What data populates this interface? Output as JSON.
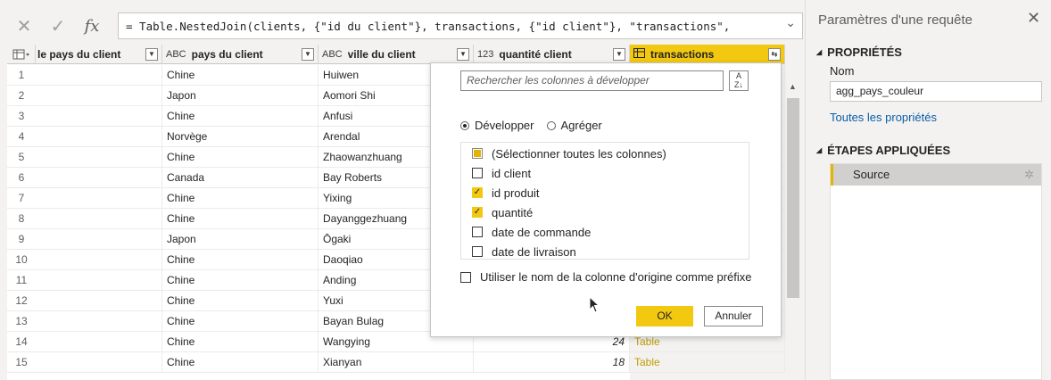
{
  "formula_bar": {
    "cancel_icon": "close-icon",
    "confirm_icon": "check-icon",
    "fx_label": "fx",
    "formula": "= Table.NestedJoin(clients, {\"id du client\"}, transactions, {\"id client\"}, \"transactions\","
  },
  "grid": {
    "columns": [
      {
        "type": "",
        "label": "le pays du client"
      },
      {
        "type": "ABC",
        "label": "pays du client"
      },
      {
        "type": "ABC",
        "label": "ville du client"
      },
      {
        "type": "123",
        "label": "quantité client"
      },
      {
        "type": "",
        "label": "transactions"
      }
    ],
    "rows": [
      {
        "n": "1",
        "pays": "Chine",
        "ville": "Huiwen",
        "qte": "",
        "trans": ""
      },
      {
        "n": "2",
        "pays": "Japon",
        "ville": "Aomori Shi",
        "qte": "",
        "trans": ""
      },
      {
        "n": "3",
        "pays": "Chine",
        "ville": "Anfusi",
        "qte": "",
        "trans": ""
      },
      {
        "n": "4",
        "pays": "Norvège",
        "ville": "Arendal",
        "qte": "",
        "trans": ""
      },
      {
        "n": "5",
        "pays": "Chine",
        "ville": "Zhaowanzhuang",
        "qte": "",
        "trans": ""
      },
      {
        "n": "6",
        "pays": "Canada",
        "ville": "Bay Roberts",
        "qte": "",
        "trans": ""
      },
      {
        "n": "7",
        "pays": "Chine",
        "ville": "Yixing",
        "qte": "",
        "trans": ""
      },
      {
        "n": "8",
        "pays": "Chine",
        "ville": "Dayanggezhuang",
        "qte": "",
        "trans": ""
      },
      {
        "n": "9",
        "pays": "Japon",
        "ville": "Ōgaki",
        "qte": "",
        "trans": ""
      },
      {
        "n": "10",
        "pays": "Chine",
        "ville": "Daoqiao",
        "qte": "",
        "trans": ""
      },
      {
        "n": "11",
        "pays": "Chine",
        "ville": "Anding",
        "qte": "",
        "trans": ""
      },
      {
        "n": "12",
        "pays": "Chine",
        "ville": "Yuxi",
        "qte": "",
        "trans": ""
      },
      {
        "n": "13",
        "pays": "Chine",
        "ville": "Bayan Bulag",
        "qte": "",
        "trans": ""
      },
      {
        "n": "14",
        "pays": "Chine",
        "ville": "Wangying",
        "qte": "24",
        "trans": "Table"
      },
      {
        "n": "15",
        "pays": "Chine",
        "ville": "Xianyan",
        "qte": "18",
        "trans": "Table"
      }
    ]
  },
  "popup": {
    "search_placeholder": "Rechercher les colonnes à développer",
    "sort_icon": "sort-az-icon",
    "radio_expand": "Développer",
    "radio_aggregate": "Agréger",
    "selected_mode": "Développer",
    "columns": [
      {
        "label": "(Sélectionner toutes les colonnes)",
        "state": "partial"
      },
      {
        "label": "id client",
        "state": "off"
      },
      {
        "label": "id produit",
        "state": "on"
      },
      {
        "label": "quantité",
        "state": "on"
      },
      {
        "label": "date de commande",
        "state": "off"
      },
      {
        "label": "date de livraison",
        "state": "off"
      }
    ],
    "prefix_label": "Utiliser le nom de la colonne d'origine comme préfixe",
    "ok_label": "OK",
    "cancel_label": "Annuler"
  },
  "right_panel": {
    "title": "Paramètres d'une requête",
    "properties_heading": "PROPRIÉTÉS",
    "name_label": "Nom",
    "name_value": "agg_pays_couleur",
    "all_properties_link": "Toutes les propriétés",
    "steps_heading": "ÉTAPES APPLIQUÉES",
    "steps": [
      {
        "label": "Source"
      }
    ]
  },
  "colors": {
    "accent": "#f2c811",
    "table_link": "#c19c00",
    "link": "#0a5ea8"
  }
}
